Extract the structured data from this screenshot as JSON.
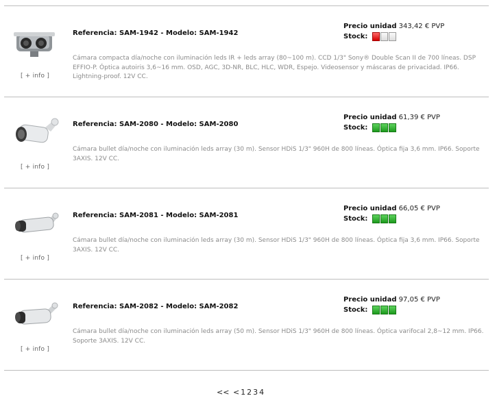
{
  "products": [
    {
      "reference": "Referencia: SAM-1942 - Modelo: SAM-1942",
      "description": "Cámara compacta día/noche con iluminación leds IR + leds array (80~100 m). CCD 1/3\" Sony® Double Scan II de 700 líneas. DSP EFFIO-P. Óptica autoiris 3,6~16 mm. OSD, AGC, 3D-NR, BLC, HLC, WDR, Espejo. Videosensor y máscaras de privacidad. IP66. Lightning-proof. 12V CC.",
      "price_label": "Precio unidad",
      "price": "343,42 € PVP",
      "stock_label": "Stock:",
      "stock_level": 1,
      "stock_color": "#d40000",
      "info_link": "[ + info ]",
      "image_icon": "compact-camera-icon"
    },
    {
      "reference": "Referencia: SAM-2080 - Modelo: SAM-2080",
      "description": "Cámara bullet día/noche con iluminación leds array (30 m). Sensor HDiS 1/3\" 960H de 800 líneas. Óptica fija 3,6 mm. IP66. Soporte 3AXIS. 12V CC.",
      "price_label": "Precio unidad",
      "price": "61,39 € PVP",
      "stock_label": "Stock:",
      "stock_level": 3,
      "stock_color": "#1d9a1d",
      "info_link": "[ + info ]",
      "image_icon": "bullet-camera-icon"
    },
    {
      "reference": "Referencia: SAM-2081 - Modelo: SAM-2081",
      "description": "Cámara bullet día/noche con iluminación leds array (30 m). Sensor HDiS 1/3\" 960H de 800 líneas. Óptica fija 3,6 mm. IP66. Soporte 3AXIS. 12V CC.",
      "price_label": "Precio unidad",
      "price": "66,05 € PVP",
      "stock_label": "Stock:",
      "stock_level": 3,
      "stock_color": "#1d9a1d",
      "info_link": "[ + info ]",
      "image_icon": "bullet-camera-icon"
    },
    {
      "reference": "Referencia: SAM-2082 - Modelo: SAM-2082",
      "description": "Cámara bullet día/noche con iluminación leds array (50 m). Sensor HDiS 1/3\" 960H de 800 líneas. Óptica varifocal 2,8~12 mm. IP66. Soporte 3AXIS. 12V CC.",
      "price_label": "Precio unidad",
      "price": "97,05 € PVP",
      "stock_label": "Stock:",
      "stock_level": 3,
      "stock_color": "#1d9a1d",
      "info_link": "[ + info ]",
      "image_icon": "bullet-camera-icon"
    }
  ],
  "pagination": {
    "first": "<<",
    "prev": "<",
    "pages": [
      "1",
      "2",
      "3",
      "4"
    ]
  }
}
